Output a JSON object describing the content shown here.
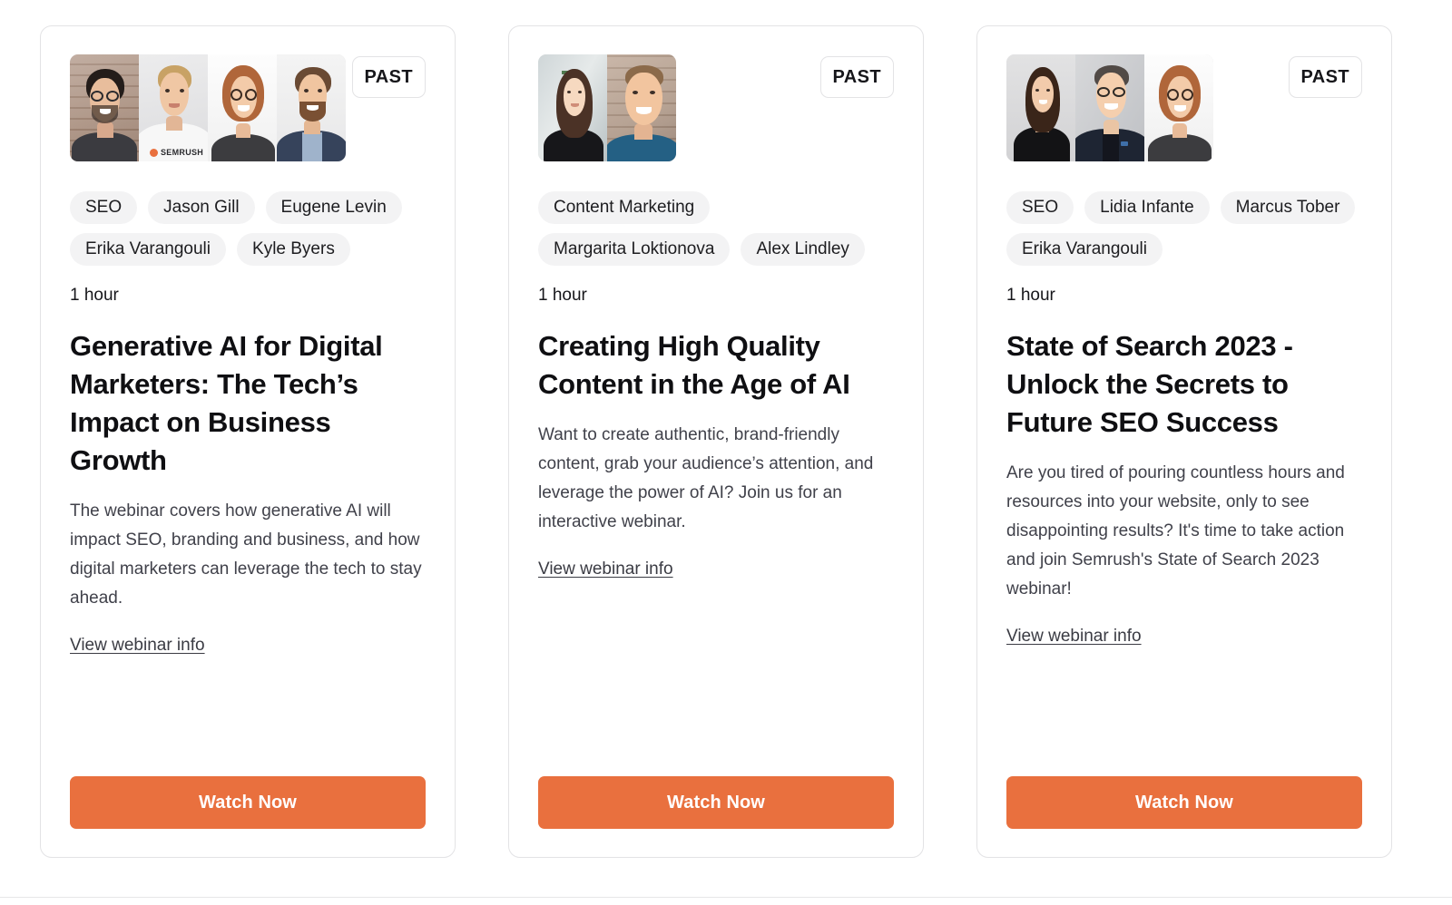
{
  "page": {
    "background_color": "#ffffff",
    "accent_color": "#e9703e",
    "pill_color": "#f3f3f4",
    "border_color": "#e3e3e5"
  },
  "cards": [
    {
      "badge": "PAST",
      "tags": [
        "SEO",
        "Jason Gill",
        "Eugene Levin",
        "Erika Varangouli",
        "Kyle Byers"
      ],
      "duration": "1 hour",
      "title": "Generative AI for Digital Marketers: The Tech’s Impact on Business Growth",
      "description": "The webinar covers how generative AI will impact SEO, branding and business, and how digital marketers can leverage the tech to stay ahead.",
      "link_label": "View webinar info",
      "cta_label": "Watch Now",
      "speakers_count": 4
    },
    {
      "badge": "PAST",
      "tags": [
        "Content Marketing",
        "Margarita Loktionova",
        "Alex Lindley"
      ],
      "duration": "1 hour",
      "title": "Creating High Quality Content in the Age of AI",
      "description": "Want to create authentic, brand-friendly content, grab your audience’s attention, and leverage the power of AI? Join us for an interactive webinar.",
      "link_label": "View webinar info",
      "cta_label": "Watch Now",
      "speakers_count": 2
    },
    {
      "badge": "PAST",
      "tags": [
        "SEO",
        "Lidia Infante",
        "Marcus Tober",
        "Erika Varangouli"
      ],
      "duration": "1 hour",
      "title": "State of Search 2023 - Unlock the Secrets to Future SEO Success",
      "description": "Are you tired of pouring countless hours and resources into your website, only to see disappointing results? It's time to take action and join Semrush's State of Search 2023 webinar!",
      "link_label": "View webinar info",
      "cta_label": "Watch Now",
      "speakers_count": 3
    }
  ]
}
